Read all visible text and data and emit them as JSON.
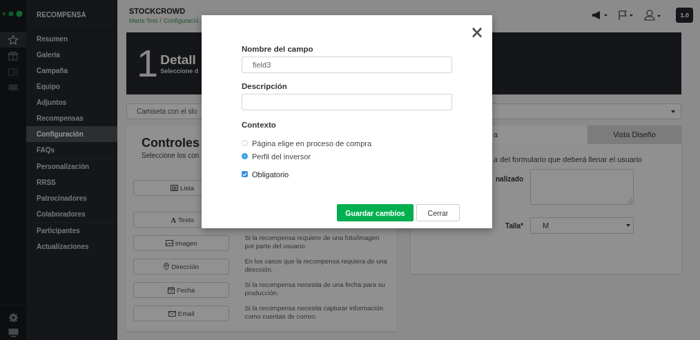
{
  "rail": {
    "items": [
      {
        "kind": "star",
        "selected": true
      },
      {
        "kind": "gift",
        "selected": false
      },
      {
        "kind": "money",
        "selected": false
      },
      {
        "kind": "people",
        "selected": false
      }
    ],
    "bottom": [
      {
        "kind": "gear"
      },
      {
        "kind": "monitor"
      }
    ]
  },
  "sidebar": {
    "title": "RECOMPENSA",
    "groups": [
      [
        {
          "label": "Resumen",
          "selected": false
        },
        {
          "label": "Galería",
          "selected": false
        },
        {
          "label": "Campaña",
          "selected": false
        },
        {
          "label": "Equipo",
          "selected": false
        },
        {
          "label": "Adjuntos",
          "selected": false
        },
        {
          "label": "Recompensas",
          "selected": false
        },
        {
          "label": "Configuración",
          "selected": true
        },
        {
          "label": "FAQs",
          "selected": false
        }
      ],
      [
        {
          "label": "Personalización",
          "selected": false
        },
        {
          "label": "RRSS",
          "selected": false
        },
        {
          "label": "Patrocinadores",
          "selected": false
        },
        {
          "label": "Colaboradores",
          "selected": false
        }
      ],
      [
        {
          "label": "Participantes",
          "selected": false
        },
        {
          "label": "Actualizaciones",
          "selected": false
        }
      ]
    ]
  },
  "header": {
    "brand": "STOCKCROWD",
    "breadcrumb": [
      "Maria Test",
      "Configuració"
    ],
    "separator": "/",
    "version": "1.0"
  },
  "banner": {
    "number": "1",
    "title": "Detall",
    "subtitle": "Seleccione d"
  },
  "reward_select": {
    "value": "Camiseta con el slo"
  },
  "controls": {
    "title": "Controles",
    "subtitle": "Seleccione los con",
    "items": [
      {
        "kind": "list",
        "label": "Lista"
      },
      {
        "kind": "text",
        "glyph": "A",
        "label": "Texto"
      },
      {
        "kind": "image",
        "label": "Imagen",
        "description": "Si la recompensa requiere de una foto/imagen por parte del usuario."
      },
      {
        "kind": "pin",
        "label": "Dirección",
        "description": "En los casos que la recompensa requiera de una dirección."
      },
      {
        "kind": "date",
        "label": "Fecha",
        "description": "Si la recompensa necesita de una fecha para su producción."
      },
      {
        "kind": "mail",
        "label": "Email",
        "description": "Si la recompensa necesita capturar información como cuentas de correo."
      }
    ]
  },
  "preview": {
    "tabs": [
      {
        "label": "a",
        "selected": true
      },
      {
        "label": "Vista Diseño",
        "selected": false
      }
    ],
    "intro": "a del formulario que deberá llenar el usuario",
    "fields": [
      {
        "kind": "textarea",
        "label": "nalizado"
      },
      {
        "kind": "select",
        "label": "Talla*",
        "value": "M"
      }
    ]
  },
  "modal": {
    "close": "×",
    "fields": [
      {
        "label": "Nombre del campo",
        "value": "field3"
      },
      {
        "label": "Descripción"
      }
    ],
    "context_label": "Contexto",
    "options": [
      {
        "label": "Página elige en proceso de compra",
        "selected": false
      },
      {
        "label": "Perfil del inversor",
        "selected": true
      }
    ],
    "required": {
      "label": "Obligatorio",
      "checked": true
    },
    "buttons": [
      {
        "label": "Guardar cambios",
        "kind": "primary"
      },
      {
        "label": "Cerrar",
        "kind": "default"
      }
    ]
  }
}
